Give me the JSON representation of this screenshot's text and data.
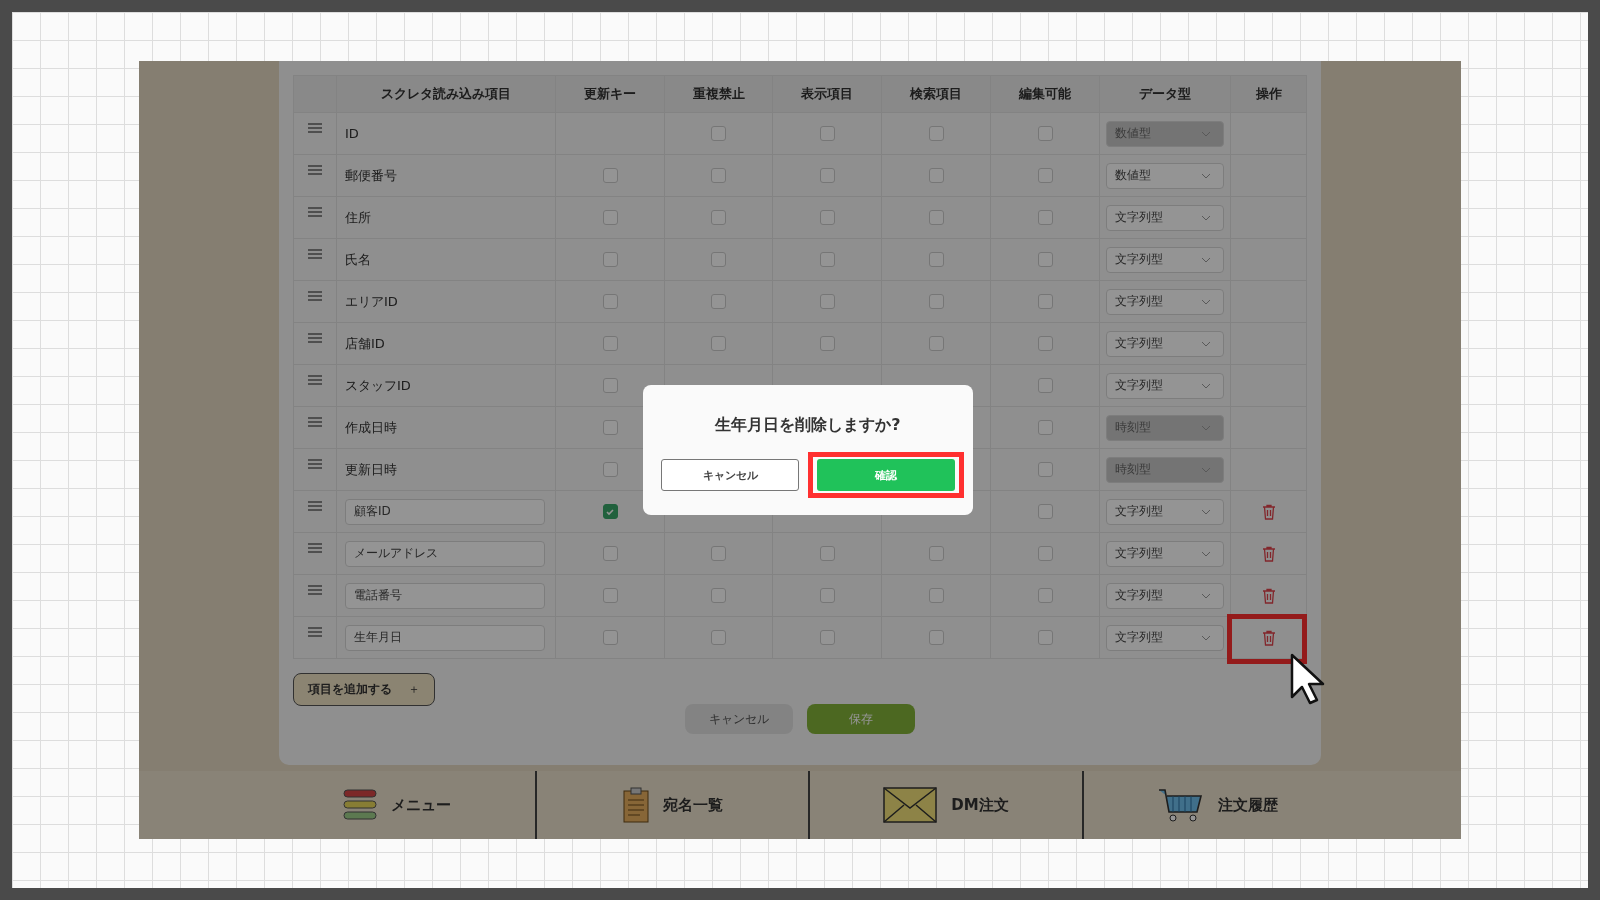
{
  "table": {
    "columns": [
      "スクレタ読み込み項目",
      "更新キー",
      "重複禁止",
      "表示項目",
      "検索項目",
      "編集可能",
      "データ型",
      "操作"
    ],
    "rows": [
      {
        "kind": "static",
        "label": "ID",
        "checks": {
          "duplicate": {
            "checked": false
          },
          "display": {
            "checked": false
          },
          "search": {
            "checked": false
          },
          "editable": {
            "checked": false
          }
        },
        "data_type": "数値型",
        "locked": true
      },
      {
        "kind": "static",
        "label": "郵便番号",
        "checks": {
          "update_key": {
            "checked": false
          },
          "duplicate": {
            "checked": false
          },
          "display": {
            "checked": false
          },
          "search": {
            "checked": false
          },
          "editable": {
            "checked": false
          }
        },
        "data_type": "数値型",
        "locked": false
      },
      {
        "kind": "static",
        "label": "住所",
        "checks": {
          "update_key": {
            "checked": false
          },
          "duplicate": {
            "checked": false
          },
          "display": {
            "checked": false
          },
          "search": {
            "checked": false
          },
          "editable": {
            "checked": false
          }
        },
        "data_type": "文字列型",
        "locked": false
      },
      {
        "kind": "static",
        "label": "氏名",
        "checks": {
          "update_key": {
            "checked": false
          },
          "duplicate": {
            "checked": false
          },
          "display": {
            "checked": false
          },
          "search": {
            "checked": false
          },
          "editable": {
            "checked": false
          }
        },
        "data_type": "文字列型",
        "locked": false
      },
      {
        "kind": "static",
        "label": "エリアID",
        "checks": {
          "update_key": {
            "checked": false
          },
          "duplicate": {
            "checked": false
          },
          "display": {
            "checked": false
          },
          "search": {
            "checked": false
          },
          "editable": {
            "checked": false
          }
        },
        "data_type": "文字列型",
        "locked": false
      },
      {
        "kind": "static",
        "label": "店舗ID",
        "checks": {
          "update_key": {
            "checked": false
          },
          "duplicate": {
            "checked": false
          },
          "display": {
            "checked": false
          },
          "search": {
            "checked": false
          },
          "editable": {
            "checked": false
          }
        },
        "data_type": "文字列型",
        "locked": false
      },
      {
        "kind": "static",
        "label": "スタッフID",
        "checks": {
          "update_key": {
            "checked": false
          },
          "editable": {
            "checked": false
          }
        },
        "data_type": "文字列型",
        "locked": false
      },
      {
        "kind": "static",
        "label": "作成日時",
        "checks": {
          "update_key": {
            "checked": false
          },
          "editable": {
            "checked": false
          }
        },
        "data_type": "時刻型",
        "locked": true
      },
      {
        "kind": "static",
        "label": "更新日時",
        "checks": {
          "update_key": {
            "checked": false
          },
          "editable": {
            "checked": false
          }
        },
        "data_type": "時刻型",
        "locked": true
      },
      {
        "kind": "input",
        "label": "顧客ID",
        "checks": {
          "update_key": {
            "checked": true
          },
          "editable": {
            "checked": false
          }
        },
        "data_type": "文字列型",
        "locked": false,
        "deletable": true
      },
      {
        "kind": "input",
        "label": "メールアドレス",
        "checks": {
          "update_key": {
            "checked": false
          },
          "duplicate": {
            "checked": false
          },
          "display": {
            "checked": false
          },
          "search": {
            "checked": false
          },
          "editable": {
            "checked": false
          }
        },
        "data_type": "文字列型",
        "locked": false,
        "deletable": true
      },
      {
        "kind": "input",
        "label": "電話番号",
        "checks": {
          "update_key": {
            "checked": false
          },
          "duplicate": {
            "checked": false
          },
          "display": {
            "checked": false
          },
          "search": {
            "checked": false
          },
          "editable": {
            "checked": false
          }
        },
        "data_type": "文字列型",
        "locked": false,
        "deletable": true
      },
      {
        "kind": "input",
        "label": "生年月日",
        "checks": {
          "update_key": {
            "checked": false
          },
          "duplicate": {
            "checked": false
          },
          "display": {
            "checked": false
          },
          "search": {
            "checked": false
          },
          "editable": {
            "checked": false
          }
        },
        "data_type": "文字列型",
        "locked": false,
        "deletable": true,
        "highlighted": true
      }
    ]
  },
  "add_button": {
    "label": "項目を追加する",
    "icon": "＋"
  },
  "footer_buttons": [
    {
      "label": "キャンセル",
      "kind": "cancel"
    },
    {
      "label": "保存",
      "kind": "save"
    }
  ],
  "dialog": {
    "message": "生年月日を削除しますか?",
    "buttons": [
      {
        "label": "キャンセル",
        "kind": "cancel"
      },
      {
        "label": "確認",
        "kind": "confirm",
        "highlighted": true
      }
    ]
  },
  "nav": [
    {
      "label": "メニュー",
      "kind": "menu"
    },
    {
      "label": "宛名一覧",
      "kind": "list"
    },
    {
      "label": "DM注文",
      "kind": "mail"
    },
    {
      "label": "注文履歴",
      "kind": "cart"
    }
  ]
}
